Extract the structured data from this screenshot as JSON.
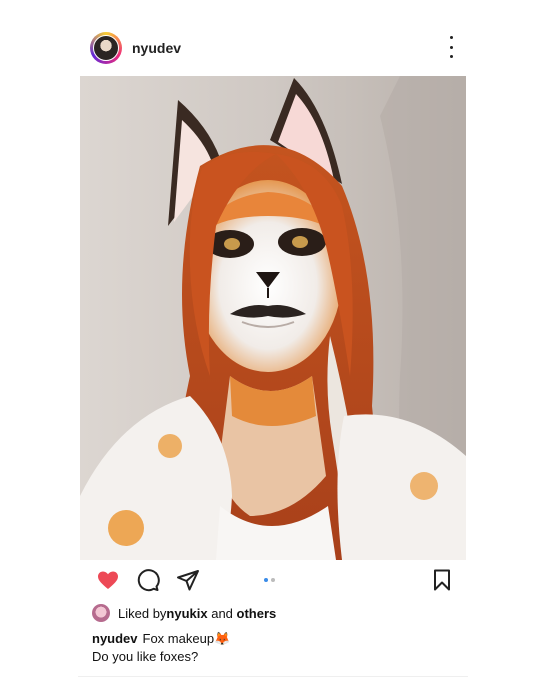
{
  "post": {
    "username": "nyudev",
    "caption_user": "nyudev",
    "caption_text": "Fox makeup🦊",
    "caption_line2": "Do you like foxes?"
  },
  "likes": {
    "prefix": "Liked by ",
    "user": "nyukix",
    "middle": " and ",
    "others": "others"
  },
  "carousel": {
    "total": 2,
    "active": 1
  },
  "colors": {
    "like": "#ed4956",
    "carousel_active": "#3b8ce8",
    "hair": "#c9531f"
  },
  "icons": [
    "more-options-icon",
    "heart-icon",
    "comment-icon",
    "share-icon",
    "bookmark-icon"
  ]
}
